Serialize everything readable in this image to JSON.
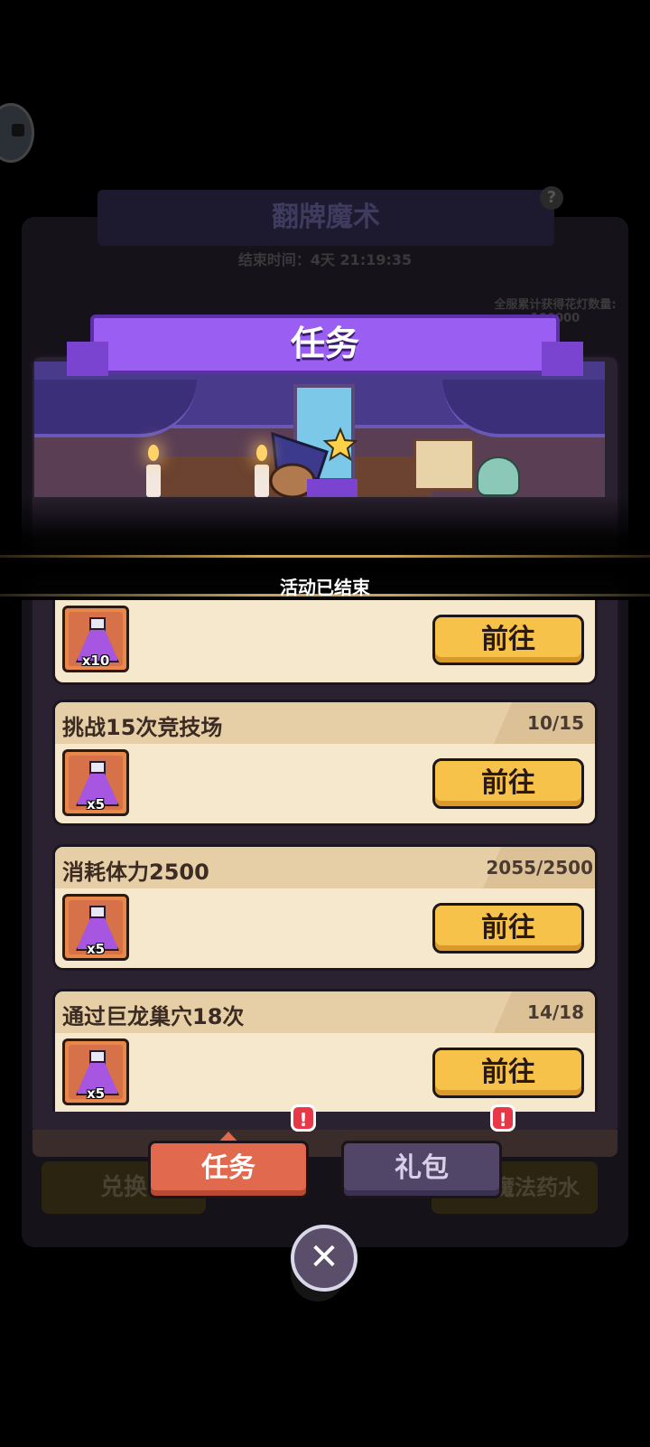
{
  "background": {
    "banner_title": "翻牌魔术",
    "end_time": "结束时间：4天 21:19:35",
    "server_stat_label": "全服累计获得花灯数量:",
    "server_stat_value": "100000",
    "buttons": [
      "兑换",
      "获得魔法药水"
    ],
    "help_icon": "question-icon"
  },
  "modal": {
    "title": "任务",
    "ended_notice": "活动已结束",
    "tasks": [
      {
        "title": "",
        "progress": "",
        "reward_qty": "x10",
        "button": "前往"
      },
      {
        "title": "挑战15次竞技场",
        "progress": "10/15",
        "reward_qty": "x5",
        "button": "前往"
      },
      {
        "title": "消耗体力2500",
        "progress": "2055/2500",
        "reward_qty": "x5",
        "button": "前往"
      },
      {
        "title": "通过巨龙巢穴18次",
        "progress": "14/18",
        "reward_qty": "x5",
        "button": "前往"
      }
    ],
    "reward_icon": "potion-flask-icon",
    "tabs": [
      {
        "label": "任务",
        "active": true,
        "badge": "!"
      },
      {
        "label": "礼包",
        "active": false,
        "badge": "!"
      }
    ],
    "close_icon": "close-icon"
  },
  "colors": {
    "title_ribbon": "#9a5ef2",
    "go_button": "#f7c24a",
    "tab_active": "#e16a4e",
    "tab_inactive": "#514668",
    "badge": "#e83848"
  }
}
